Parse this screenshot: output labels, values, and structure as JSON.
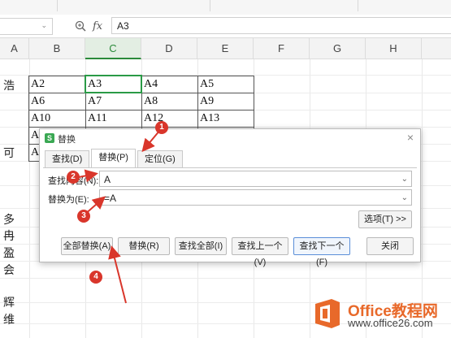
{
  "formula_bar": {
    "name_box_arrow": "⌄",
    "fx": "fx",
    "content": "A3"
  },
  "columns": [
    {
      "label": "A",
      "selected": false
    },
    {
      "label": "B",
      "selected": false
    },
    {
      "label": "C",
      "selected": true
    },
    {
      "label": "D",
      "selected": false
    },
    {
      "label": "E",
      "selected": false
    },
    {
      "label": "F",
      "selected": false
    },
    {
      "label": "G",
      "selected": false
    },
    {
      "label": "H",
      "selected": false
    }
  ],
  "table": {
    "rows": [
      [
        "A2",
        "A3",
        "A4",
        "A5"
      ],
      [
        "A6",
        "A7",
        "A8",
        "A9"
      ],
      [
        "A10",
        "A11",
        "A12",
        "A13"
      ],
      [
        "A",
        "",
        "",
        ""
      ],
      [
        "A",
        "",
        "",
        ""
      ]
    ]
  },
  "left_column_chars": [
    "浩",
    "可",
    "多",
    "冉",
    "盈",
    "会",
    "辉",
    "维"
  ],
  "dialog": {
    "title": "替换",
    "logo": "S",
    "close": "×",
    "tabs": [
      "查找(D)",
      "替换(P)",
      "定位(G)"
    ],
    "active_tab": 1,
    "find_label": "查找内容(N):",
    "find_value": "A",
    "replace_label": "替换为(E):",
    "replace_value": "=A",
    "options_button": "选项(T) >>",
    "buttons": {
      "replace_all": "全部替换(A)",
      "replace": "替换(R)",
      "find_all": "查找全部(I)",
      "find_prev": "查找上一个(V)",
      "find_next": "查找下一个(F)",
      "close": "关闭"
    }
  },
  "markers": [
    "1",
    "2",
    "3",
    "4"
  ],
  "watermark": {
    "brand": "Office教程网",
    "url": "www.office26.com"
  },
  "colors": {
    "accent_green": "#2a9a46",
    "marker_red": "#d9362b",
    "watermark_orange": "#e8692a"
  }
}
